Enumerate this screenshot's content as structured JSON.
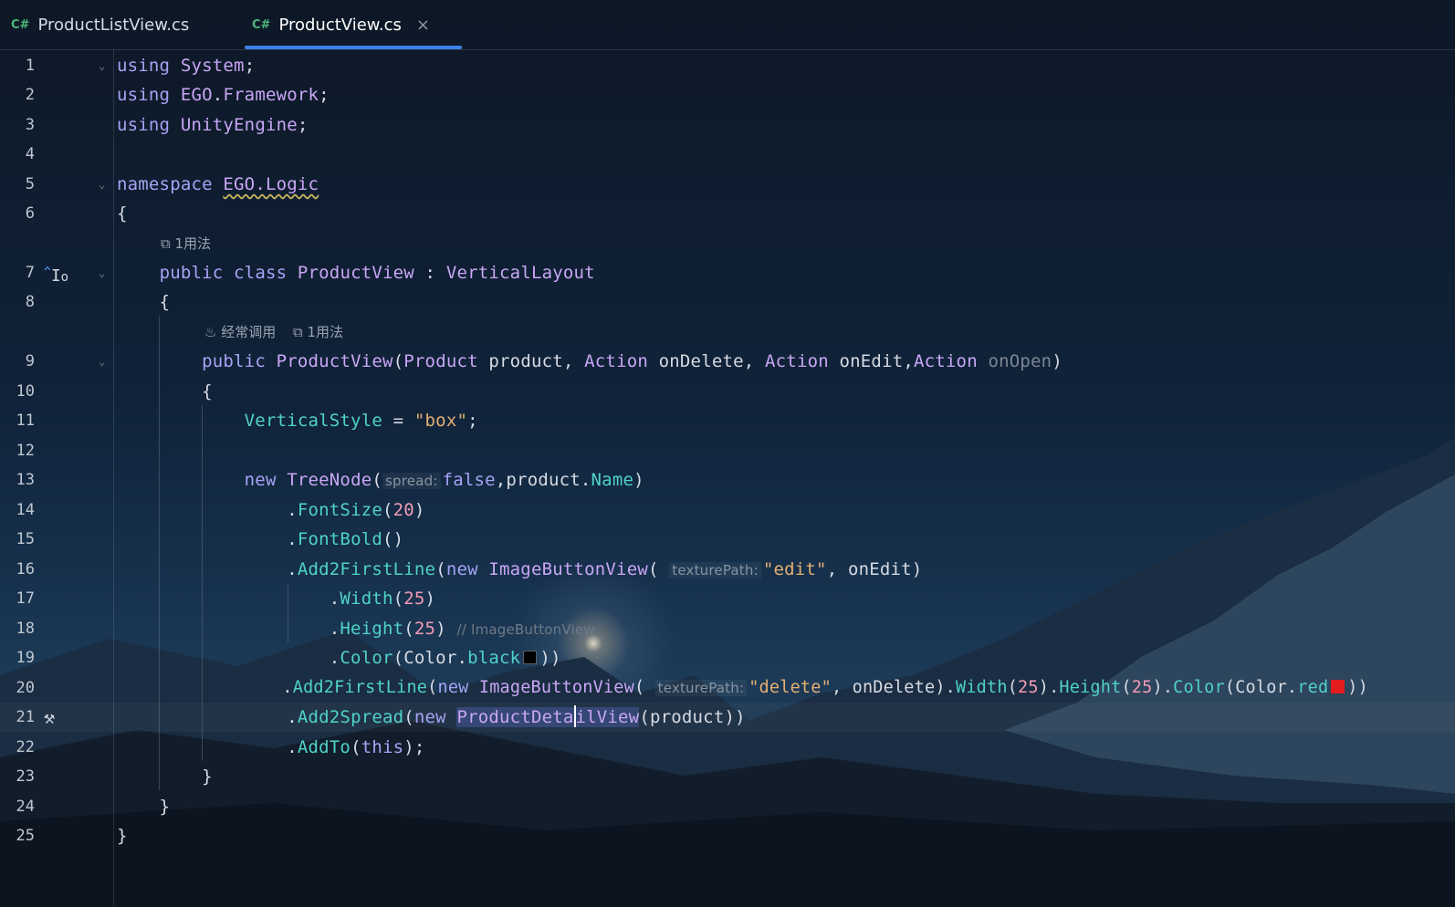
{
  "tabs": [
    {
      "lang": "C#",
      "label": "ProductListView.cs",
      "active": false
    },
    {
      "lang": "C#",
      "label": "ProductView.cs",
      "active": true,
      "close": "×"
    }
  ],
  "hints": {
    "usage_1": "1用法",
    "frequent": "经常调用",
    "usage_2": "1用法"
  },
  "param_hints": {
    "spread": "spread:",
    "texturePath": "texturePath:"
  },
  "comment_18": "// ImageButtonView",
  "line_numbers": [
    "1",
    "2",
    "3",
    "4",
    "5",
    "6",
    "7",
    "8",
    "9",
    "10",
    "11",
    "12",
    "13",
    "14",
    "15",
    "16",
    "17",
    "18",
    "19",
    "20",
    "21",
    "22",
    "23",
    "24",
    "25"
  ],
  "colors": {
    "keyword": "#a7a3f5",
    "type": "#c9a6f5",
    "method": "#4fd2c7",
    "string": "#e4b073",
    "number": "#f39bb7",
    "tab_underline": "#3b82e8",
    "swatch_black": "#000000",
    "swatch_red": "#e21d1d"
  },
  "gutter_icons": {
    "line7": "implements-icon",
    "line21": "hammer-icon"
  }
}
